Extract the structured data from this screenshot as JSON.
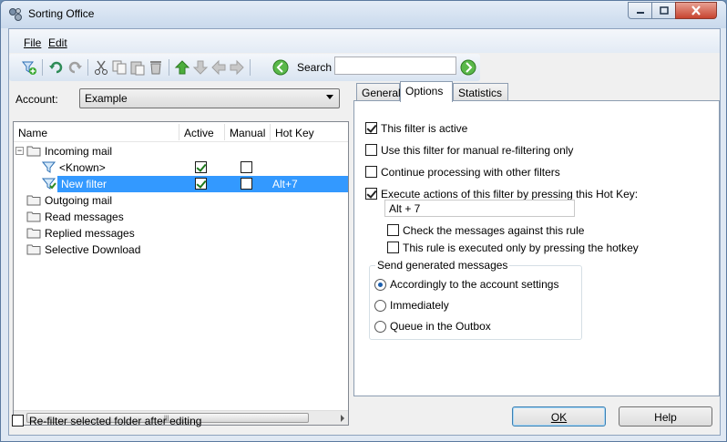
{
  "window": {
    "title": "Sorting Office",
    "caption_buttons": [
      "minimize",
      "maximize",
      "close"
    ]
  },
  "menu": {
    "items": [
      "File",
      "Edit"
    ]
  },
  "toolbar": {
    "icons": [
      "new-filter-icon",
      "undo-icon",
      "redo-icon",
      "cut-icon",
      "copy-icon",
      "paste-icon",
      "delete-icon",
      "move-up-icon",
      "move-down-icon",
      "move-left-icon",
      "move-right-icon",
      "search-back-icon",
      "search-forward-icon"
    ],
    "search_label": "Search",
    "search_value": ""
  },
  "account": {
    "label": "Account:",
    "value": "Example"
  },
  "tree": {
    "columns": [
      "Name",
      "Active",
      "Manual",
      "Hot Key"
    ],
    "rows": [
      {
        "name": "Incoming mail",
        "kind": "folder",
        "expanded": true
      },
      {
        "name": "<Known>",
        "kind": "filter",
        "active": true,
        "manual": false,
        "hotkey": ""
      },
      {
        "name": "New filter",
        "kind": "filter",
        "active": true,
        "manual": false,
        "hotkey": "Alt+7",
        "selected": true
      },
      {
        "name": "Outgoing mail",
        "kind": "folder"
      },
      {
        "name": "Read messages",
        "kind": "folder"
      },
      {
        "name": "Replied messages",
        "kind": "folder"
      },
      {
        "name": "Selective Download",
        "kind": "folder"
      }
    ]
  },
  "refilter": {
    "label": "Re-filter selected folder after editing",
    "checked": false
  },
  "tabs": [
    "General",
    "Options",
    "Statistics"
  ],
  "active_tab": "Options",
  "options": {
    "active": {
      "label": "This filter is active",
      "checked": true
    },
    "manual": {
      "label": "Use this filter for manual re-filtering only",
      "checked": false
    },
    "continue": {
      "label": "Continue processing with other filters",
      "checked": false
    },
    "hotkey": {
      "label": "Execute actions of this filter by pressing this Hot Key:",
      "checked": true,
      "value": "Alt + 7"
    },
    "check_messages": {
      "label": "Check the messages against this rule",
      "checked": false
    },
    "only_hotkey": {
      "label": "This rule is executed only by pressing the hotkey",
      "checked": false
    }
  },
  "send_group": {
    "title": "Send generated messages",
    "options": [
      "Accordingly to the account settings",
      "Immediately",
      "Queue in the Outbox"
    ],
    "selected": 0
  },
  "buttons": {
    "ok": "OK",
    "help": "Help"
  }
}
